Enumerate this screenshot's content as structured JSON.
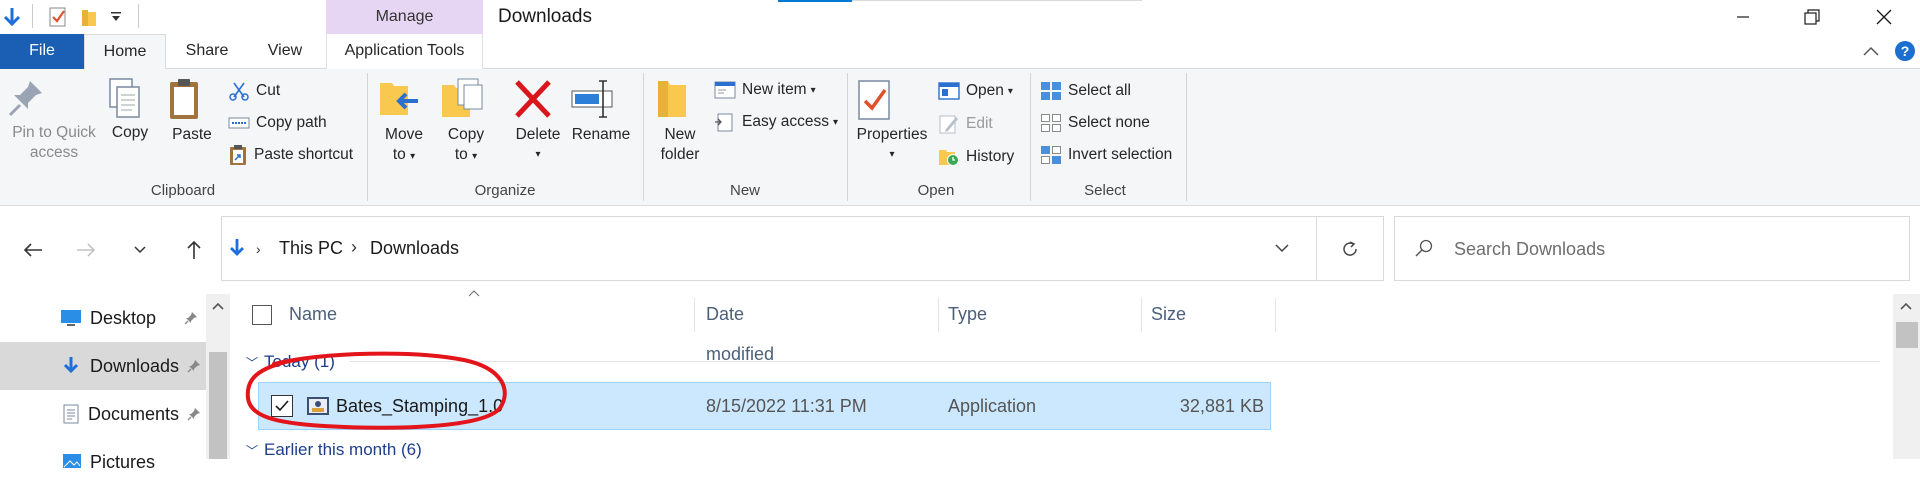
{
  "window": {
    "title": "Downloads",
    "contextual_tab_group": "Manage"
  },
  "ribbon_tabs": {
    "file": "File",
    "home": "Home",
    "share": "Share",
    "view": "View",
    "application_tools": "Application Tools"
  },
  "ribbon": {
    "clipboard": {
      "label": "Clipboard",
      "pin_line1": "Pin to Quick",
      "pin_line2": "access",
      "copy": "Copy",
      "paste": "Paste",
      "cut": "Cut",
      "copy_path": "Copy path",
      "paste_shortcut": "Paste shortcut"
    },
    "organize": {
      "label": "Organize",
      "move_line1": "Move",
      "move_line2": "to",
      "copy_line1": "Copy",
      "copy_line2": "to",
      "delete": "Delete",
      "rename": "Rename"
    },
    "new": {
      "label": "New",
      "folder_line1": "New",
      "folder_line2": "folder",
      "new_item": "New item",
      "easy_access": "Easy access"
    },
    "open": {
      "label": "Open",
      "properties": "Properties",
      "open": "Open",
      "edit": "Edit",
      "history": "History"
    },
    "select": {
      "label": "Select",
      "select_all": "Select all",
      "select_none": "Select none",
      "invert": "Invert selection"
    }
  },
  "address": {
    "crumbs": [
      "This PC",
      "Downloads"
    ],
    "search_placeholder": "Search Downloads"
  },
  "nav_pane": {
    "items": [
      "Desktop",
      "Downloads",
      "Documents",
      "Pictures"
    ]
  },
  "columns": {
    "name": "Name",
    "date_modified": "Date modified",
    "type": "Type",
    "size": "Size"
  },
  "groups": {
    "today": "Today (1)",
    "earlier_month": "Earlier this month (6)"
  },
  "files": [
    {
      "name": "Bates_Stamping_1.0",
      "date_modified": "8/15/2022 11:31 PM",
      "type": "Application",
      "size": "32,881 KB",
      "selected": true
    }
  ],
  "colors": {
    "accent": "#1a5fb4",
    "manage_tab": "#e7d6f3",
    "selection": "#cce8ff",
    "annotation": "#e3151a"
  }
}
